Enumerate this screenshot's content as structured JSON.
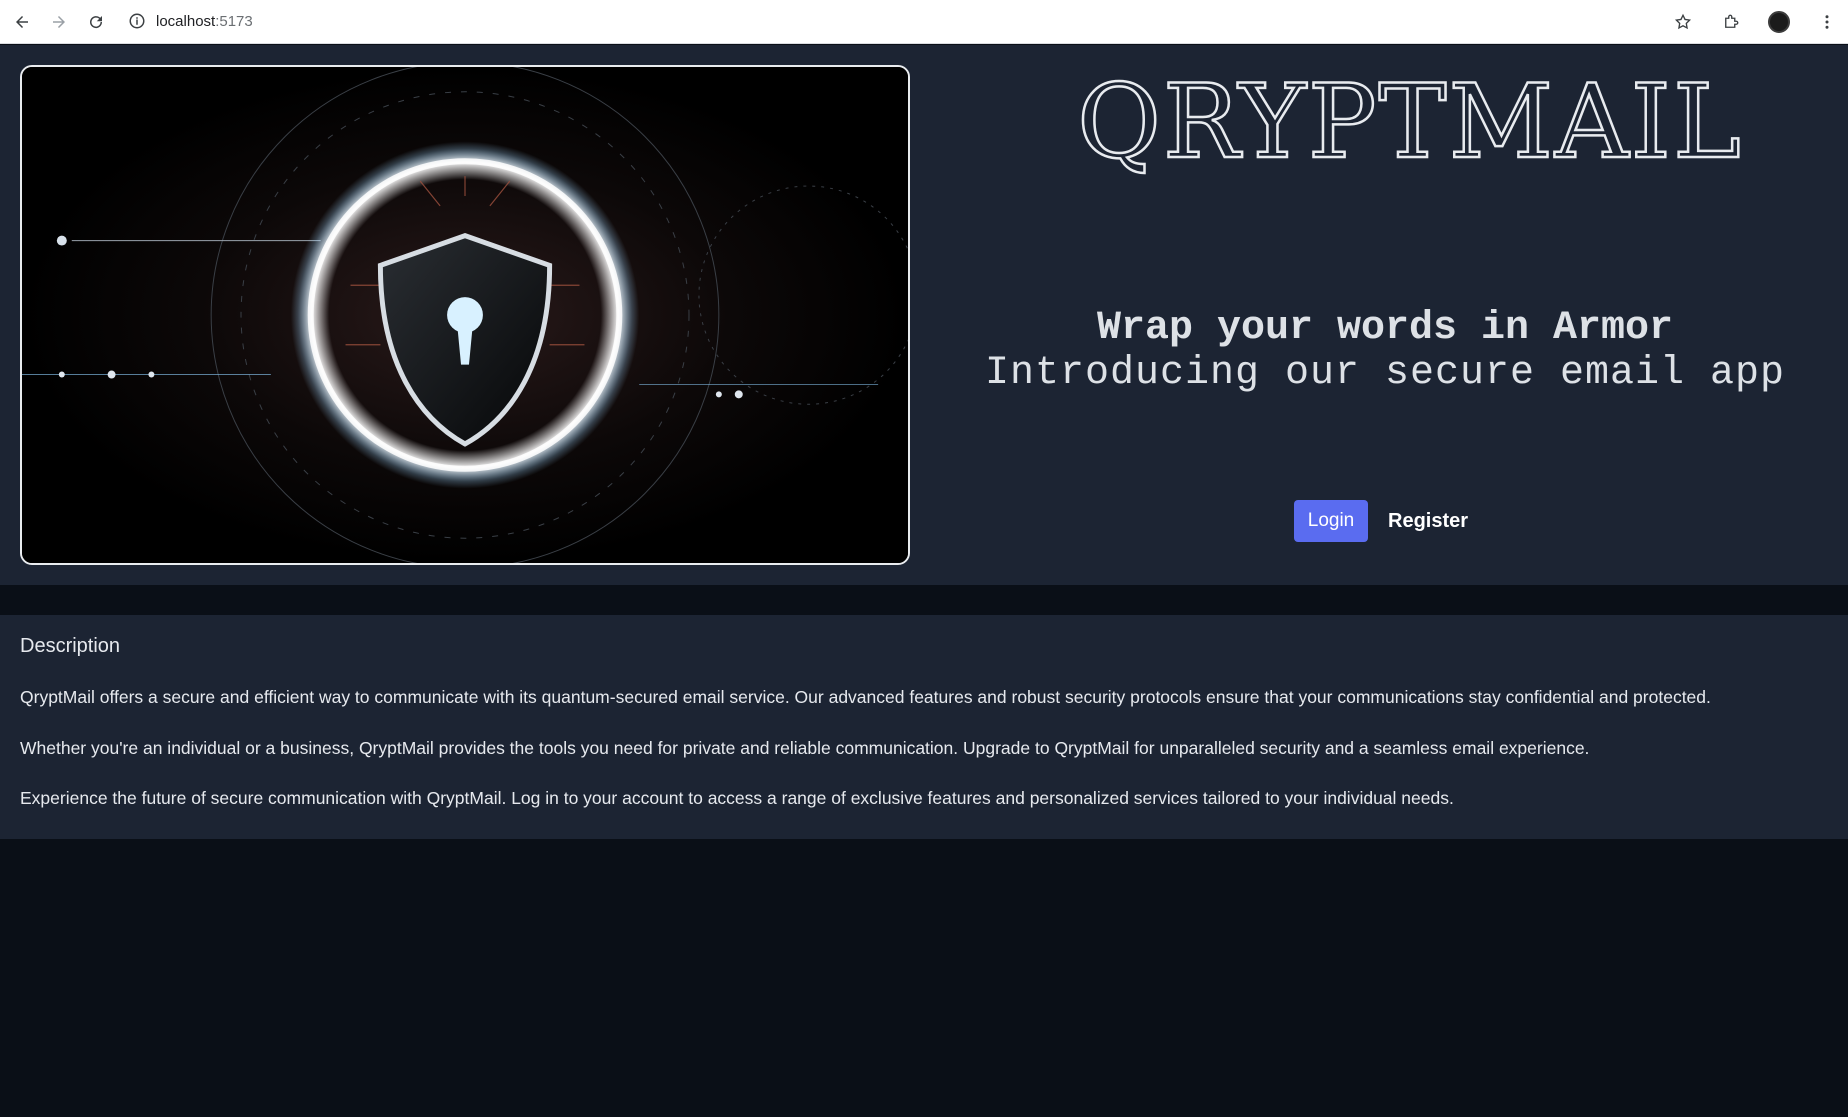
{
  "browser": {
    "url_host": "localhost",
    "url_port": ":5173"
  },
  "hero": {
    "brand": "QRYPTMAIL",
    "tagline_primary": "Wrap your words in Armor",
    "tagline_secondary": "Introducing our secure email app",
    "login_label": "Login",
    "register_label": "Register"
  },
  "description": {
    "title": "Description",
    "paragraphs": [
      "QryptMail offers a secure and efficient way to communicate with its quantum-secured email service. Our advanced features and robust security protocols ensure that your communications stay confidential and protected.",
      "Whether you're an individual or a business, QryptMail provides the tools you need for private and reliable communication. Upgrade to QryptMail for unparalleled security and a seamless email experience.",
      "Experience the future of secure communication with QryptMail. Log in to your account to access a range of exclusive features and personalized services tailored to your individual needs."
    ]
  },
  "colors": {
    "page_background": "#0a0f17",
    "panel_background": "#1c2433",
    "accent": "#5a6cf0",
    "text": "#e6e9ee"
  }
}
